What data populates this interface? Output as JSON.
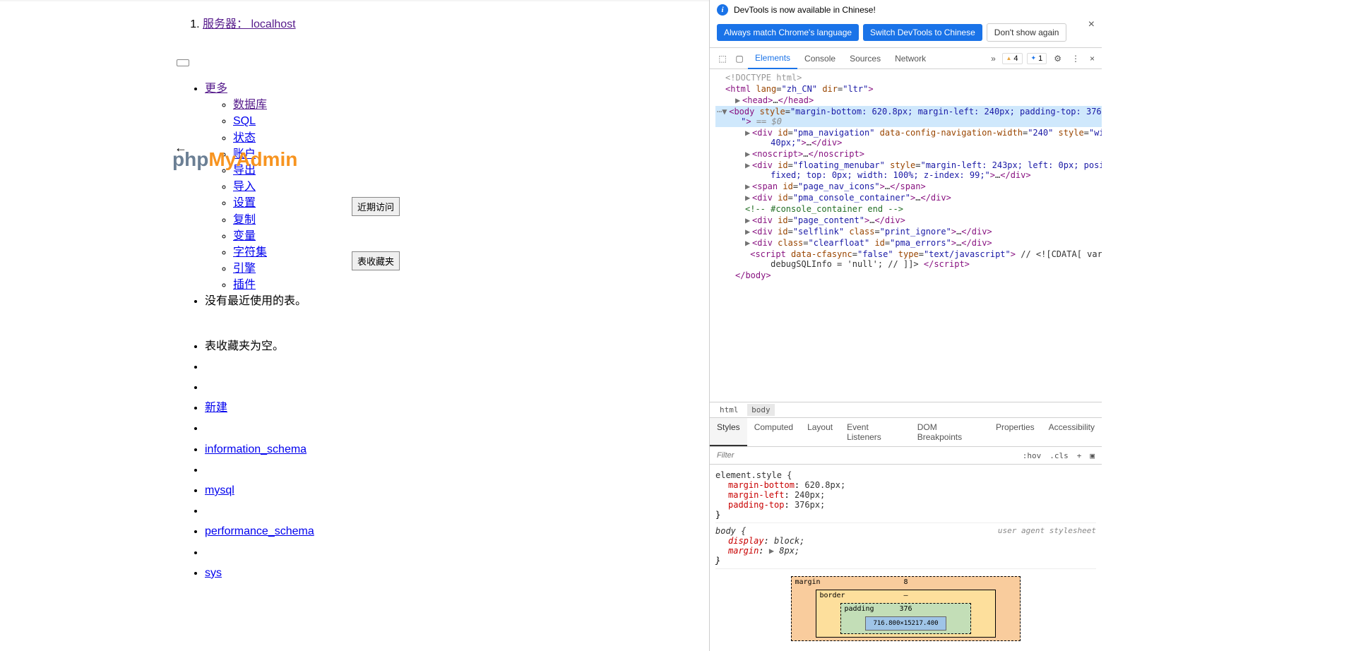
{
  "server": {
    "prefix": "服务器：",
    "name": "localhost"
  },
  "menu": {
    "more": "更多",
    "items": [
      "  数据库",
      "  SQL",
      "  状态",
      "  账户",
      "  导出",
      "  导入",
      "  设置",
      "  复制",
      "  变量",
      "  字符集",
      "  引擎",
      "  插件"
    ]
  },
  "overlap_text": "没有最近使用的表。",
  "btn_recent": "近期访问",
  "btn_fav": "表收藏夹",
  "fav_empty": "表收藏夹为空。",
  "links": [
    "新建",
    "information_schema",
    "mysql",
    "performance_schema",
    "sys"
  ],
  "devtools": {
    "banner_text": "DevTools is now available in Chinese!",
    "btn_match": "Always match Chrome's language",
    "btn_switch": "Switch DevTools to Chinese",
    "btn_dont": "Don't show again",
    "tabs": [
      "Elements",
      "Console",
      "Sources",
      "Network"
    ],
    "warn_count": "4",
    "info_count": "1",
    "breadcrumb": [
      "html",
      "body"
    ],
    "styles_tabs": [
      "Styles",
      "Computed",
      "Layout",
      "Event Listeners",
      "DOM Breakpoints",
      "Properties",
      "Accessibility"
    ],
    "filter_placeholder": "Filter",
    "hov": ":hov",
    "cls": ".cls",
    "element_style": "element.style {",
    "rule1": [
      {
        "prop": "margin-bottom",
        "val": "620.8px"
      },
      {
        "prop": "margin-left",
        "val": "240px"
      },
      {
        "prop": "padding-top",
        "val": "376px"
      }
    ],
    "body_rule": "body {",
    "ua_label": "user agent stylesheet",
    "rule2": [
      {
        "prop": "display",
        "val": "block"
      },
      {
        "prop": "margin",
        "val": "8px",
        "tri": true
      }
    ],
    "boxmodel": {
      "margin_label": "margin",
      "margin_top": "8",
      "border_label": "border",
      "border_top": "–",
      "padding_label": "padding",
      "padding_top": "376",
      "content": "716.800×15217.400"
    }
  }
}
